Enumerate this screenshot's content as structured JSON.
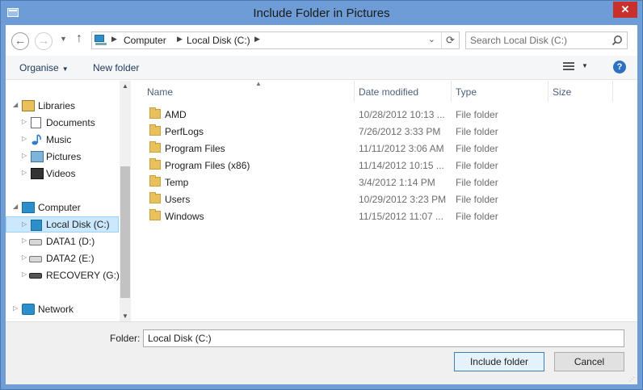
{
  "window": {
    "title": "Include Folder in Pictures",
    "close_glyph": "✕"
  },
  "address": {
    "back_glyph": "←",
    "forward_glyph": "→",
    "recent_glyph": "▼",
    "up_glyph": "↑",
    "crumbs": [
      "Computer",
      "Local Disk (C:)"
    ],
    "crumb_sep": "▶",
    "dropdown_glyph": "⌄",
    "refresh_glyph": "⟳",
    "search_placeholder": "Search Local Disk (C:)"
  },
  "toolbar": {
    "organise_label": "Organise",
    "organise_arrow": "▼",
    "new_folder_label": "New folder",
    "view_arrow": "▼",
    "help_glyph": "?"
  },
  "nav": {
    "libraries": {
      "label": "Libraries",
      "expand": "◢"
    },
    "library_items": [
      {
        "label": "Documents",
        "icon": "document-icon"
      },
      {
        "label": "Music",
        "icon": "music-icon"
      },
      {
        "label": "Pictures",
        "icon": "pictures-icon"
      },
      {
        "label": "Videos",
        "icon": "videos-icon"
      }
    ],
    "computer": {
      "label": "Computer",
      "expand": "◢"
    },
    "computer_items": [
      {
        "label": "Local Disk (C:)",
        "icon": "local-disk-icon",
        "selected": true
      },
      {
        "label": "DATA1 (D:)",
        "icon": "drive-icon"
      },
      {
        "label": "DATA2 (E:)",
        "icon": "drive-icon"
      },
      {
        "label": "RECOVERY (G:)",
        "icon": "drive-icon"
      }
    ],
    "network": {
      "label": "Network",
      "expand": "▷"
    },
    "collapsed_glyph": "▷",
    "scroll_up": "▲",
    "scroll_down": "▼"
  },
  "columns": {
    "name": "Name",
    "date": "Date modified",
    "type": "Type",
    "size": "Size",
    "sort_glyph": "▲"
  },
  "files": [
    {
      "name": "AMD",
      "date": "10/28/2012 10:13 ...",
      "type": "File folder"
    },
    {
      "name": "PerfLogs",
      "date": "7/26/2012 3:33 PM",
      "type": "File folder"
    },
    {
      "name": "Program Files",
      "date": "11/11/2012 3:06 AM",
      "type": "File folder"
    },
    {
      "name": "Program Files (x86)",
      "date": "11/14/2012 10:15 ...",
      "type": "File folder"
    },
    {
      "name": "Temp",
      "date": "3/4/2012 1:14 PM",
      "type": "File folder"
    },
    {
      "name": "Users",
      "date": "10/29/2012 3:23 PM",
      "type": "File folder"
    },
    {
      "name": "Windows",
      "date": "11/15/2012 11:07 ...",
      "type": "File folder"
    }
  ],
  "footer": {
    "folder_label": "Folder:",
    "folder_value": "Local Disk (C:)",
    "include_button": "Include folder",
    "cancel_button": "Cancel",
    "grip_glyph": "⋰"
  },
  "colors": {
    "titlebar": "#6d9cd6",
    "close": "#c7302b",
    "selection": "#cce8ff"
  }
}
